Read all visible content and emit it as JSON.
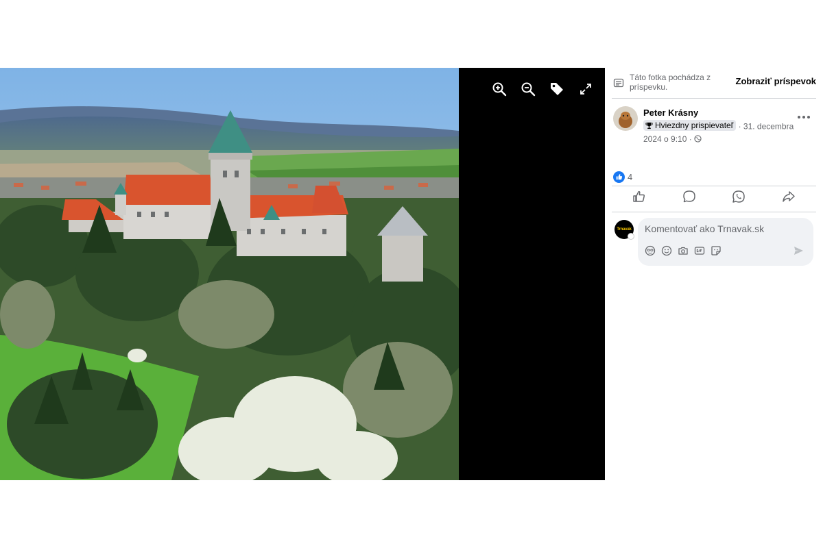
{
  "viewer": {
    "tools": [
      {
        "icon": "zoom-in-icon"
      },
      {
        "icon": "zoom-out-icon"
      },
      {
        "icon": "tag-icon"
      },
      {
        "icon": "fullscreen-icon"
      }
    ]
  },
  "panel": {
    "source_text": "Táto fotka pochádza z príspevku.",
    "view_post_label": "Zobraziť príspevok",
    "author": {
      "name": "Peter Krásny",
      "badge": "Hviezdny prispievateľ",
      "date_part1": "· 31. decembra",
      "date_part2": "2024 o 9:10 ·"
    },
    "reactions": {
      "like_count": "4"
    },
    "actions": [
      {
        "icon": "like-icon"
      },
      {
        "icon": "comment-icon"
      },
      {
        "icon": "whatsapp-icon"
      },
      {
        "icon": "share-icon"
      }
    ],
    "comment": {
      "avatar_text": "Trnavak",
      "placeholder": "Komentovať ako Trnavak.sk"
    }
  },
  "colors": {
    "accent": "#1877f2",
    "viewer_bg": "#000000",
    "muted_text": "#65676b"
  }
}
